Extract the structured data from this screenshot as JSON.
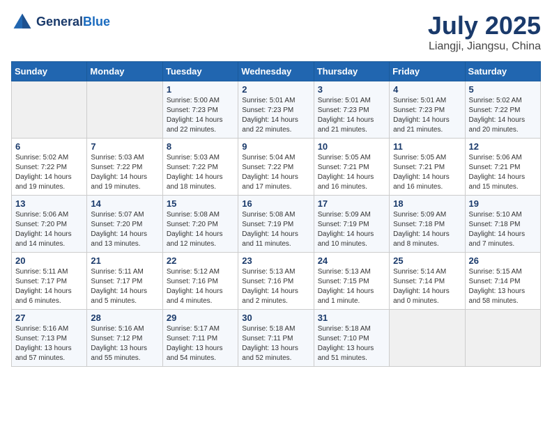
{
  "header": {
    "logo_line1": "General",
    "logo_line2": "Blue",
    "month": "July 2025",
    "location": "Liangji, Jiangsu, China"
  },
  "weekdays": [
    "Sunday",
    "Monday",
    "Tuesday",
    "Wednesday",
    "Thursday",
    "Friday",
    "Saturday"
  ],
  "weeks": [
    [
      {
        "day": "",
        "info": ""
      },
      {
        "day": "",
        "info": ""
      },
      {
        "day": "1",
        "info": "Sunrise: 5:00 AM\nSunset: 7:23 PM\nDaylight: 14 hours\nand 22 minutes."
      },
      {
        "day": "2",
        "info": "Sunrise: 5:01 AM\nSunset: 7:23 PM\nDaylight: 14 hours\nand 22 minutes."
      },
      {
        "day": "3",
        "info": "Sunrise: 5:01 AM\nSunset: 7:23 PM\nDaylight: 14 hours\nand 21 minutes."
      },
      {
        "day": "4",
        "info": "Sunrise: 5:01 AM\nSunset: 7:23 PM\nDaylight: 14 hours\nand 21 minutes."
      },
      {
        "day": "5",
        "info": "Sunrise: 5:02 AM\nSunset: 7:22 PM\nDaylight: 14 hours\nand 20 minutes."
      }
    ],
    [
      {
        "day": "6",
        "info": "Sunrise: 5:02 AM\nSunset: 7:22 PM\nDaylight: 14 hours\nand 19 minutes."
      },
      {
        "day": "7",
        "info": "Sunrise: 5:03 AM\nSunset: 7:22 PM\nDaylight: 14 hours\nand 19 minutes."
      },
      {
        "day": "8",
        "info": "Sunrise: 5:03 AM\nSunset: 7:22 PM\nDaylight: 14 hours\nand 18 minutes."
      },
      {
        "day": "9",
        "info": "Sunrise: 5:04 AM\nSunset: 7:22 PM\nDaylight: 14 hours\nand 17 minutes."
      },
      {
        "day": "10",
        "info": "Sunrise: 5:05 AM\nSunset: 7:21 PM\nDaylight: 14 hours\nand 16 minutes."
      },
      {
        "day": "11",
        "info": "Sunrise: 5:05 AM\nSunset: 7:21 PM\nDaylight: 14 hours\nand 16 minutes."
      },
      {
        "day": "12",
        "info": "Sunrise: 5:06 AM\nSunset: 7:21 PM\nDaylight: 14 hours\nand 15 minutes."
      }
    ],
    [
      {
        "day": "13",
        "info": "Sunrise: 5:06 AM\nSunset: 7:20 PM\nDaylight: 14 hours\nand 14 minutes."
      },
      {
        "day": "14",
        "info": "Sunrise: 5:07 AM\nSunset: 7:20 PM\nDaylight: 14 hours\nand 13 minutes."
      },
      {
        "day": "15",
        "info": "Sunrise: 5:08 AM\nSunset: 7:20 PM\nDaylight: 14 hours\nand 12 minutes."
      },
      {
        "day": "16",
        "info": "Sunrise: 5:08 AM\nSunset: 7:19 PM\nDaylight: 14 hours\nand 11 minutes."
      },
      {
        "day": "17",
        "info": "Sunrise: 5:09 AM\nSunset: 7:19 PM\nDaylight: 14 hours\nand 10 minutes."
      },
      {
        "day": "18",
        "info": "Sunrise: 5:09 AM\nSunset: 7:18 PM\nDaylight: 14 hours\nand 8 minutes."
      },
      {
        "day": "19",
        "info": "Sunrise: 5:10 AM\nSunset: 7:18 PM\nDaylight: 14 hours\nand 7 minutes."
      }
    ],
    [
      {
        "day": "20",
        "info": "Sunrise: 5:11 AM\nSunset: 7:17 PM\nDaylight: 14 hours\nand 6 minutes."
      },
      {
        "day": "21",
        "info": "Sunrise: 5:11 AM\nSunset: 7:17 PM\nDaylight: 14 hours\nand 5 minutes."
      },
      {
        "day": "22",
        "info": "Sunrise: 5:12 AM\nSunset: 7:16 PM\nDaylight: 14 hours\nand 4 minutes."
      },
      {
        "day": "23",
        "info": "Sunrise: 5:13 AM\nSunset: 7:16 PM\nDaylight: 14 hours\nand 2 minutes."
      },
      {
        "day": "24",
        "info": "Sunrise: 5:13 AM\nSunset: 7:15 PM\nDaylight: 14 hours\nand 1 minute."
      },
      {
        "day": "25",
        "info": "Sunrise: 5:14 AM\nSunset: 7:14 PM\nDaylight: 14 hours\nand 0 minutes."
      },
      {
        "day": "26",
        "info": "Sunrise: 5:15 AM\nSunset: 7:14 PM\nDaylight: 13 hours\nand 58 minutes."
      }
    ],
    [
      {
        "day": "27",
        "info": "Sunrise: 5:16 AM\nSunset: 7:13 PM\nDaylight: 13 hours\nand 57 minutes."
      },
      {
        "day": "28",
        "info": "Sunrise: 5:16 AM\nSunset: 7:12 PM\nDaylight: 13 hours\nand 55 minutes."
      },
      {
        "day": "29",
        "info": "Sunrise: 5:17 AM\nSunset: 7:11 PM\nDaylight: 13 hours\nand 54 minutes."
      },
      {
        "day": "30",
        "info": "Sunrise: 5:18 AM\nSunset: 7:11 PM\nDaylight: 13 hours\nand 52 minutes."
      },
      {
        "day": "31",
        "info": "Sunrise: 5:18 AM\nSunset: 7:10 PM\nDaylight: 13 hours\nand 51 minutes."
      },
      {
        "day": "",
        "info": ""
      },
      {
        "day": "",
        "info": ""
      }
    ]
  ]
}
